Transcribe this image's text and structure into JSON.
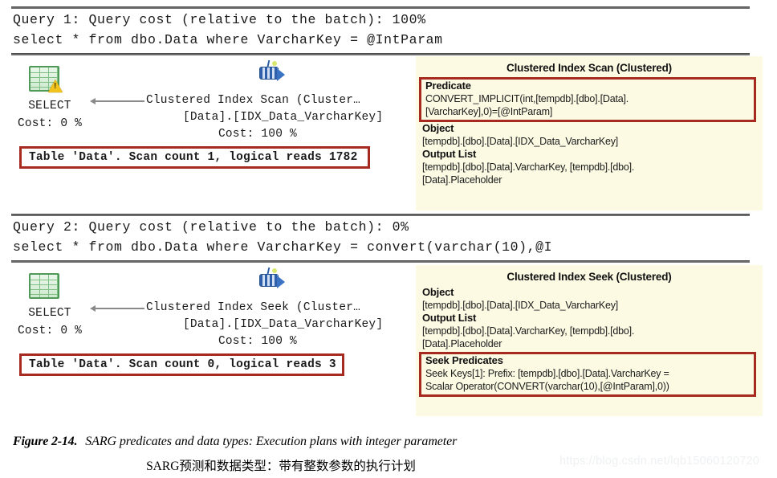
{
  "document": {
    "caption_figure_no": "Figure 2-14.",
    "caption_text": "SARG predicates and data types: Execution plans with integer parameter",
    "caption_translation": "SARG预测和数据类型：带有整数参数的执行计划",
    "watermark": "https://blog.csdn.net/lqb15060120720"
  },
  "colors": {
    "highlight_red": "#a72a20",
    "tooltip_bg": "#fdfae4",
    "rule_gray": "#6d6d6d"
  },
  "queries": [
    {
      "header": "Query 1: Query cost (relative to the batch): 100%",
      "sql": "select * from dbo.Data where VarcharKey = @IntParam",
      "plan": {
        "select_node": {
          "label": "SELECT",
          "cost": "Cost: 0 %",
          "icon": "select-result-warning-icon"
        },
        "operator_node": {
          "line1": "Clustered Index Scan (Cluster…",
          "line2": "[Data].[IDX_Data_VarcharKey]",
          "line3": "Cost: 100 %",
          "icon": "clustered-index-scan-icon"
        },
        "stats": "Table 'Data'. Scan count 1, logical reads 1782"
      },
      "tooltip": {
        "title": "Clustered Index Scan (Clustered)",
        "sections": [
          {
            "head": "Predicate",
            "body": "CONVERT_IMPLICIT(int,[tempdb].[dbo].[Data].\n[VarcharKey],0)=[@IntParam]",
            "highlighted": true
          },
          {
            "head": "Object",
            "body": "[tempdb].[dbo].[Data].[IDX_Data_VarcharKey]",
            "highlighted": false
          },
          {
            "head": "Output List",
            "body": "[tempdb].[dbo].[Data].VarcharKey, [tempdb].[dbo].\n[Data].Placeholder",
            "highlighted": false
          }
        ]
      }
    },
    {
      "header": "Query 2: Query cost (relative to the batch): 0%",
      "sql": "select * from dbo.Data where VarcharKey = convert(varchar(10),@I",
      "plan": {
        "select_node": {
          "label": "SELECT",
          "cost": "Cost: 0 %",
          "icon": "select-result-icon"
        },
        "operator_node": {
          "line1": "Clustered Index Seek (Cluster…",
          "line2": "[Data].[IDX_Data_VarcharKey]",
          "line3": "Cost: 100 %",
          "icon": "clustered-index-seek-icon"
        },
        "stats": "Table 'Data'. Scan count 0, logical reads 3"
      },
      "tooltip": {
        "title": "Clustered Index Seek (Clustered)",
        "sections": [
          {
            "head": "Object",
            "body": "[tempdb].[dbo].[Data].[IDX_Data_VarcharKey]",
            "highlighted": false
          },
          {
            "head": "Output List",
            "body": "[tempdb].[dbo].[Data].VarcharKey, [tempdb].[dbo].\n[Data].Placeholder",
            "highlighted": false
          },
          {
            "head": "Seek Predicates",
            "body": "Seek Keys[1]: Prefix: [tempdb].[dbo].[Data].VarcharKey =\nScalar Operator(CONVERT(varchar(10),[@IntParam],0))",
            "highlighted": true
          }
        ]
      }
    }
  ]
}
